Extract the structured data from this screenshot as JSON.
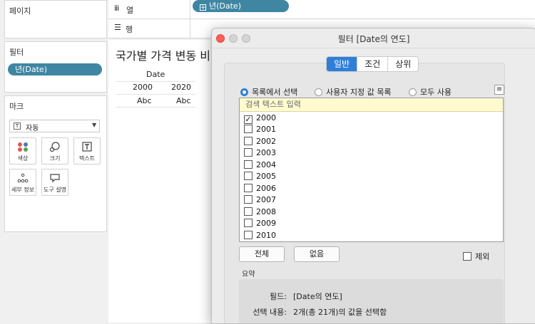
{
  "left": {
    "pages_title": "페이지",
    "filters_title": "필터",
    "filter_pill": "년(Date)",
    "marks_title": "마크",
    "marks_type": "자동",
    "mark_cards": [
      {
        "icon": "color-icon",
        "label": "색상"
      },
      {
        "icon": "size-icon",
        "label": "크기"
      },
      {
        "icon": "text-icon",
        "label": "텍스트"
      },
      {
        "icon": "detail-icon",
        "label": "세부 정보"
      },
      {
        "icon": "tooltip-icon",
        "label": "도구 설명"
      }
    ]
  },
  "shelves": {
    "columns_label": "열",
    "columns_pill": "년(Date)",
    "rows_label": "행"
  },
  "sheet": {
    "title": "국가별 가격 변동 비",
    "header": "Date",
    "years": [
      "2000",
      "2020"
    ],
    "cells": [
      "Abc",
      "Abc"
    ]
  },
  "dialog": {
    "title": "필터 [Date의 연도]",
    "tabs": [
      "일반",
      "조건",
      "상위"
    ],
    "active_tab": 0,
    "radios": [
      "목록에서 선택",
      "사용자 지정 값 목록",
      "모두 사용"
    ],
    "selected_radio": 0,
    "search_placeholder": "검색 텍스트 입력",
    "items": [
      {
        "label": "2000",
        "checked": true
      },
      {
        "label": "2001",
        "checked": false
      },
      {
        "label": "2002",
        "checked": false
      },
      {
        "label": "2003",
        "checked": false
      },
      {
        "label": "2004",
        "checked": false
      },
      {
        "label": "2005",
        "checked": false
      },
      {
        "label": "2006",
        "checked": false
      },
      {
        "label": "2007",
        "checked": false
      },
      {
        "label": "2008",
        "checked": false
      },
      {
        "label": "2009",
        "checked": false
      },
      {
        "label": "2010",
        "checked": false
      }
    ],
    "all_button": "전체",
    "none_button": "없음",
    "exclude_label": "제외",
    "summary_title": "요약",
    "summary": [
      {
        "label": "필드:",
        "value": "[Date의 연도]"
      },
      {
        "label": "선택 내용:",
        "value": "2개(총 21개)의 값을 선택함"
      }
    ],
    "colors": {
      "accent": "#2f7fd9",
      "pill": "#3f86a3",
      "close": "#fe5f57"
    }
  }
}
